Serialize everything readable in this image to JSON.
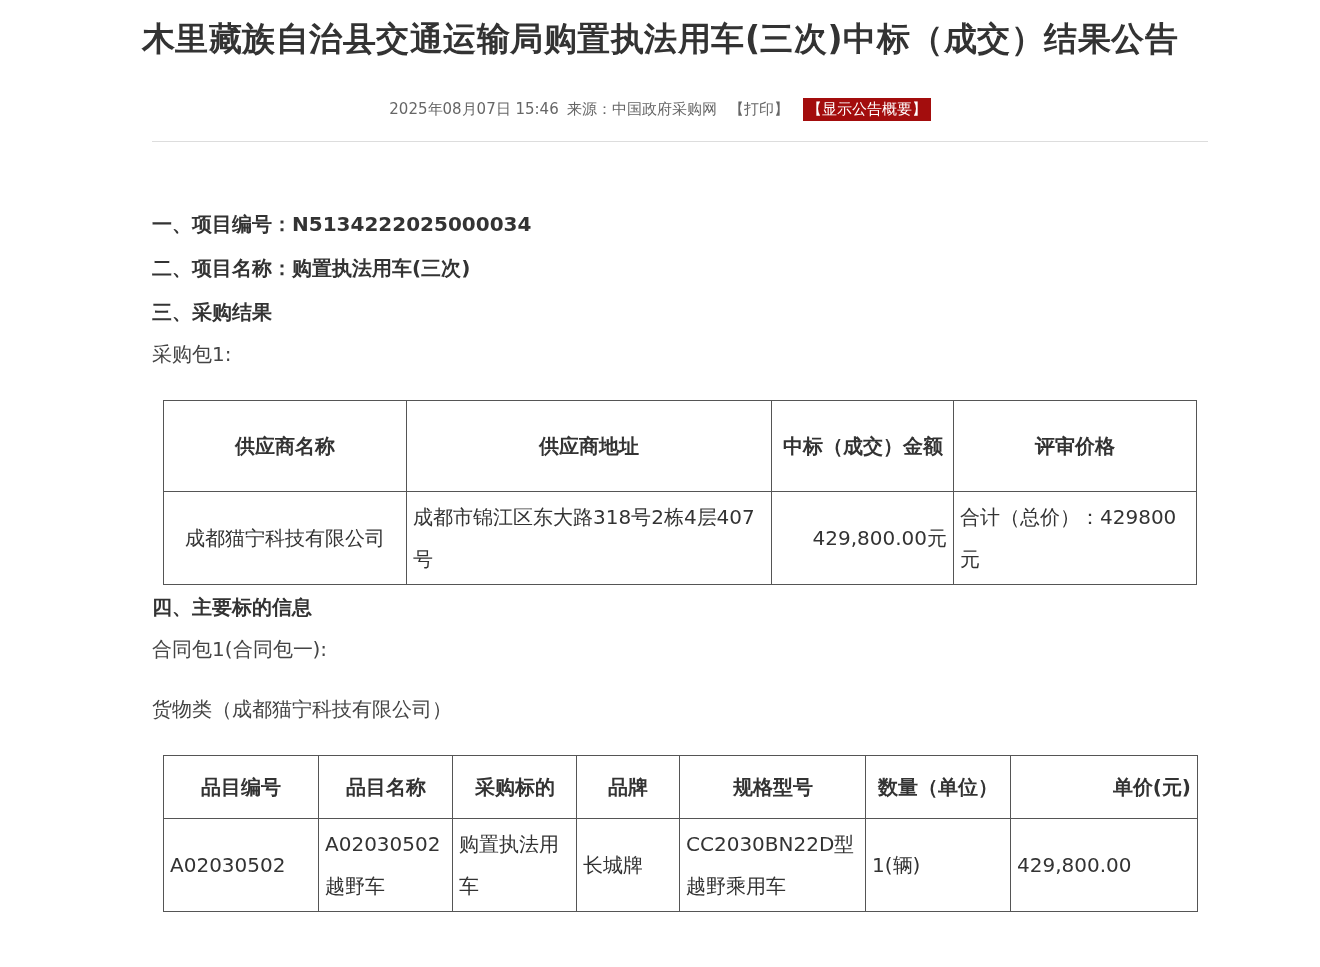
{
  "title": "木里藏族自治县交通运输局购置执法用车(三次)中标（成交）结果公告",
  "meta": {
    "date": "2025年08月07日 15:46",
    "source": "来源：中国政府采购网",
    "print": "【打印】",
    "summary_button": "【显示公告概要】"
  },
  "blocks": [
    {
      "kind": "heading",
      "text": "一、项目编号：N5134222025000034"
    },
    {
      "kind": "heading",
      "text": "二、项目名称：购置执法用车(三次)"
    },
    {
      "kind": "heading",
      "text": "三、采购结果"
    },
    {
      "kind": "paragraph",
      "text": "采购包1:"
    },
    {
      "kind": "table",
      "columns": [
        "供应商名称",
        "供应商地址",
        "中标（成交）金额",
        "评审价格"
      ],
      "rows": [
        [
          "成都猫宁科技有限公司",
          "成都市锦江区东大路318号2栋4层407号",
          "429,800.00元",
          "合计（总价）：429800元"
        ]
      ]
    },
    {
      "kind": "heading",
      "text": "四、主要标的信息"
    },
    {
      "kind": "paragraph",
      "text": "合同包1(合同包一):"
    },
    {
      "kind": "paragraph",
      "text": "货物类（成都猫宁科技有限公司）"
    },
    {
      "kind": "table",
      "columns": [
        "品目编号",
        "品目名称",
        "采购标的",
        "品牌",
        "规格型号",
        "数量（单位）",
        "单价(元)"
      ],
      "rows": [
        [
          "A02030502",
          "A02030502越野车",
          "购置执法用车",
          "长城牌",
          "CC2030BN22D型越野乘用车",
          "1(辆)",
          "429,800.00"
        ]
      ]
    }
  ]
}
